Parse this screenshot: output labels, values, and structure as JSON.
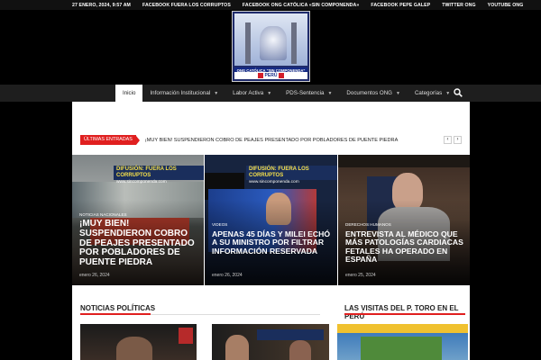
{
  "topbar": {
    "date": "27 ENERO, 2024, 9:57 AM",
    "links": [
      "FACEBOOK FUERA LOS CORRUPTOS",
      "FACEBOOK ONG CATÓLICA «SIN COMPONENDA»",
      "FACEBOOK PEPE GALEP",
      "TWITTER ONG",
      "YOUTUBE ONG"
    ]
  },
  "logo": {
    "band_text": "ONG CATÓLICA \"SIN COMPONENDA\"",
    "country": "PERÚ"
  },
  "nav": {
    "items": [
      {
        "label": "Inicio",
        "dropdown": false
      },
      {
        "label": "Información Institucional",
        "dropdown": true
      },
      {
        "label": "Labor Activa",
        "dropdown": true
      },
      {
        "label": "PDS-Sentencia",
        "dropdown": true
      },
      {
        "label": "Documentos ONG",
        "dropdown": true
      },
      {
        "label": "Categorías",
        "dropdown": true
      }
    ],
    "search_icon": "search-icon"
  },
  "ticker": {
    "label": "ÚLTIMAS ENTRADAS",
    "headline": "¡MUY BIEN! SUSPENDIERON COBRO DE PEAJES PRESENTADO POR POBLADORES DE PUENTE PIEDRA",
    "prev": "‹",
    "next": "›"
  },
  "featured": [
    {
      "banner": "DIFUSIÓN: FUERA LOS CORRUPTOS",
      "banner_url": "www.sincomponenda.com",
      "category": "NOTICIAS NACIONALES",
      "title": "¡MUY BIEN! SUSPENDIERON COBRO DE PEAJES PRESENTADO POR POBLADORES DE PUENTE PIEDRA",
      "date": "enero 26, 2024"
    },
    {
      "banner": "DIFUSIÓN: FUERA LOS CORRUPTOS",
      "banner_url": "www.sincomponenda.com",
      "category": "VIDEOS",
      "title": "APENAS 45 DÍAS Y MILEI ECHÓ A SU MINISTRO POR FILTRAR INFORMACIÓN RESERVADA",
      "date": "enero 26, 2024"
    },
    {
      "banner": "",
      "banner_url": "",
      "category": "DERECHOS HUMANOS",
      "title": "ENTREVISTA AL MÉDICO QUE MÁS PATOLOGÍAS CARDIACAS FETALES HA OPERADO EN ESPAÑA",
      "date": "enero 25, 2024"
    }
  ],
  "sections": {
    "left": "NOTICIAS POLÍTICAS",
    "right": "LAS VISITAS DEL P. TORO EN EL PERÚ"
  },
  "colors": {
    "accent": "#e01f1f",
    "banner": "#1a2e5c",
    "banner_text": "#f6e04a"
  }
}
